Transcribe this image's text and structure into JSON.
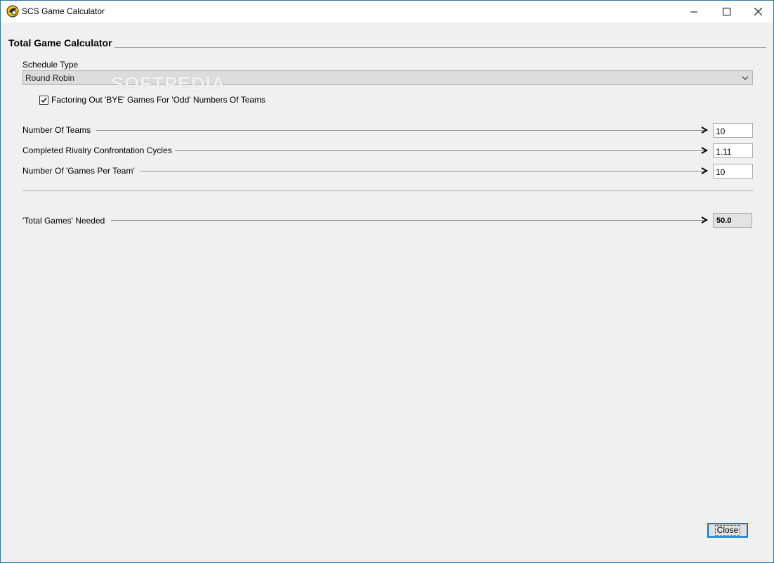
{
  "window": {
    "title": "SCS Game Calculator",
    "controls": {
      "minimize": "minimize",
      "maximize": "maximize",
      "close": "close"
    }
  },
  "section": {
    "title": "Total Game Calculator"
  },
  "schedule": {
    "label": "Schedule Type",
    "selected": "Round Robin",
    "watermark": "SOFTPEDIA"
  },
  "bye_checkbox": {
    "label": "Factoring Out 'BYE' Games For 'Odd' Numbers Of Teams",
    "checked": true
  },
  "fields": {
    "teams": {
      "label": "Number Of Teams",
      "value": "10"
    },
    "cycles": {
      "label": "Completed Rivalry Confrontation Cycles",
      "value": "1.11"
    },
    "games_per_team": {
      "label": "Number Of 'Games Per Team'",
      "value": "10"
    }
  },
  "result": {
    "label": "'Total Games' Needed",
    "value": "50.0"
  },
  "buttons": {
    "close": "Close"
  },
  "colors": {
    "window_border": "#2b7a9e",
    "focus": "#0078d7",
    "background": "#f0f0f0"
  }
}
